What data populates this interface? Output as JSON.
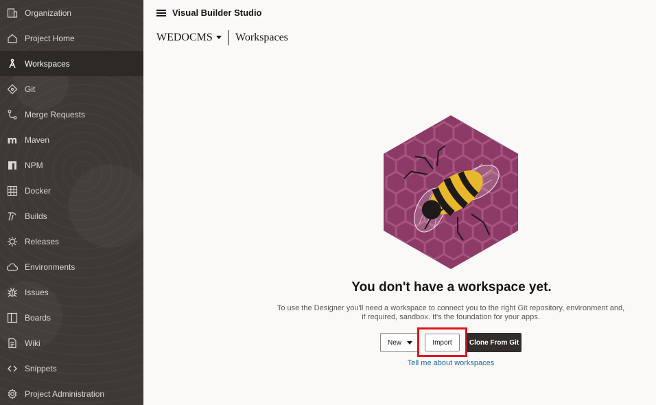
{
  "app": {
    "title": "Visual Builder Studio"
  },
  "sidebar": {
    "items": [
      {
        "label": "Organization",
        "icon": "organization-icon"
      },
      {
        "label": "Project Home",
        "icon": "home-icon"
      },
      {
        "label": "Workspaces",
        "icon": "workspaces-icon",
        "active": true
      },
      {
        "label": "Git",
        "icon": "git-icon"
      },
      {
        "label": "Merge Requests",
        "icon": "merge-requests-icon"
      },
      {
        "label": "Maven",
        "icon": "maven-icon"
      },
      {
        "label": "NPM",
        "icon": "npm-icon"
      },
      {
        "label": "Docker",
        "icon": "docker-icon"
      },
      {
        "label": "Builds",
        "icon": "builds-icon"
      },
      {
        "label": "Releases",
        "icon": "releases-icon"
      },
      {
        "label": "Environments",
        "icon": "cloud-icon"
      },
      {
        "label": "Issues",
        "icon": "bug-icon"
      },
      {
        "label": "Boards",
        "icon": "boards-icon"
      },
      {
        "label": "Wiki",
        "icon": "wiki-icon"
      },
      {
        "label": "Snippets",
        "icon": "code-icon"
      },
      {
        "label": "Project Administration",
        "icon": "gear-icon"
      }
    ]
  },
  "breadcrumb": {
    "project": "WEDOCMS",
    "current": "Workspaces"
  },
  "empty_state": {
    "title": "You don't have a workspace yet.",
    "description": "To use the Designer you'll need a workspace to connect you to the right Git repository, environment and, if required, sandbox. It's the foundation for your apps.",
    "new_label": "New",
    "import_label": "Import",
    "clone_label": "Clone From Git",
    "link_label": "Tell me about workspaces"
  },
  "colors": {
    "sidebar_bg": "#3d3934",
    "highlight": "#e0141e",
    "link": "#1a6b9a",
    "illustration_bg": "#8c3a66",
    "bee_yellow": "#e9b72c"
  }
}
